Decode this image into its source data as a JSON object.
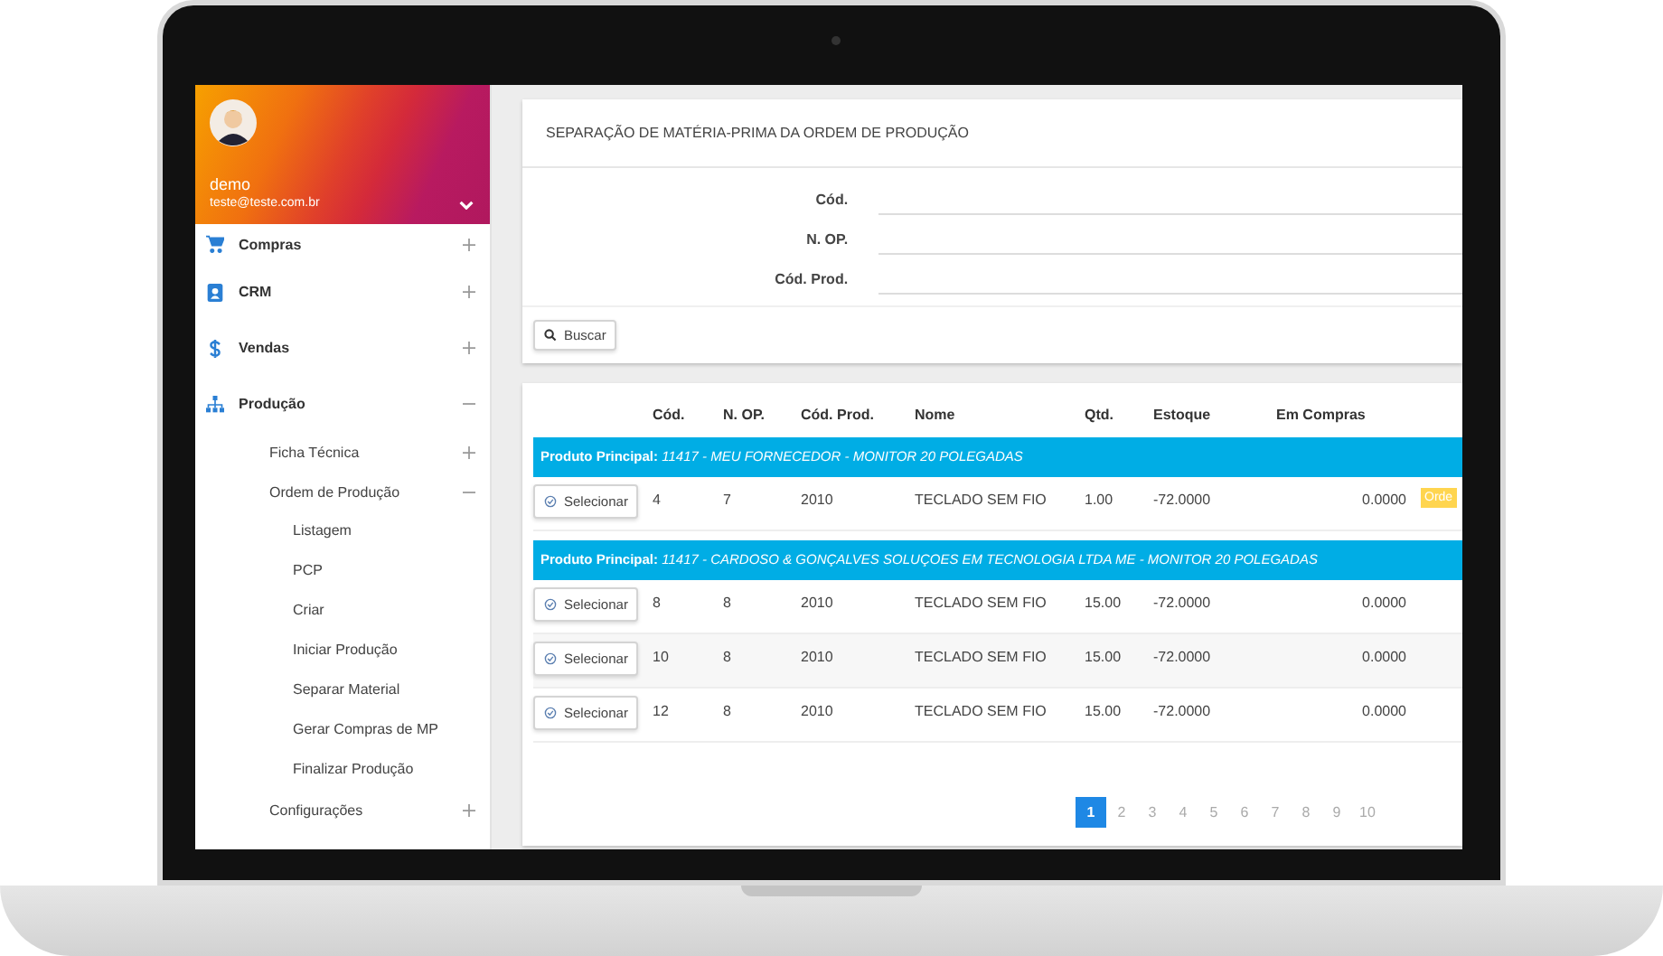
{
  "sidebar": {
    "user": {
      "name": "demo",
      "email": "teste@teste.com.br"
    },
    "items": [
      {
        "label": "Compras",
        "expanded": false
      },
      {
        "label": "CRM",
        "expanded": false
      },
      {
        "label": "Vendas",
        "expanded": false
      },
      {
        "label": "Produção",
        "expanded": true,
        "children": [
          {
            "label": "Ficha Técnica",
            "expanded": false
          },
          {
            "label": "Ordem de Produção",
            "expanded": true,
            "children": [
              {
                "label": "Listagem"
              },
              {
                "label": "PCP"
              },
              {
                "label": "Criar"
              },
              {
                "label": "Iniciar Produção"
              },
              {
                "label": "Separar Material"
              },
              {
                "label": "Gerar Compras de MP"
              },
              {
                "label": "Finalizar Produção"
              }
            ]
          },
          {
            "label": "Configurações",
            "expanded": false
          }
        ]
      }
    ]
  },
  "search_card": {
    "title": "SEPARAÇÃO DE MATÉRIA-PRIMA DA ORDEM DE PRODUÇÃO",
    "fields": [
      {
        "label": "Cód."
      },
      {
        "label": "N. OP."
      },
      {
        "label": "Cód. Prod."
      }
    ],
    "button": "Buscar"
  },
  "table": {
    "columns": [
      "Cód.",
      "N. OP.",
      "Cód. Prod.",
      "Nome",
      "Qtd.",
      "Estoque",
      "Em Compras"
    ],
    "groups": [
      {
        "label": "Produto Principal:",
        "value": "11417 - MEU FORNECEDOR - MONITOR 20 POLEGADAS",
        "rows": [
          {
            "button": "Selecionar",
            "cells": [
              "4",
              "7",
              "2010",
              "TECLADO SEM FIO",
              "1.00",
              "-72.0000",
              "0.0000"
            ],
            "badge": "Orde"
          }
        ]
      },
      {
        "label": "Produto Principal:",
        "value": "11417 - CARDOSO & GONÇALVES SOLUÇOES EM TECNOLOGIA LTDA ME - MONITOR 20 POLEGADAS",
        "rows": [
          {
            "button": "Selecionar",
            "cells": [
              "8",
              "8",
              "2010",
              "TECLADO SEM FIO",
              "15.00",
              "-72.0000",
              "0.0000"
            ]
          },
          {
            "button": "Selecionar",
            "cells": [
              "10",
              "8",
              "2010",
              "TECLADO SEM FIO",
              "15.00",
              "-72.0000",
              "0.0000"
            ]
          },
          {
            "button": "Selecionar",
            "cells": [
              "12",
              "8",
              "2010",
              "TECLADO SEM FIO",
              "15.00",
              "-72.0000",
              "0.0000"
            ]
          }
        ]
      }
    ]
  },
  "pagination": [
    {
      "label": "1",
      "selected": true
    },
    {
      "label": "2",
      "selected": false
    },
    {
      "label": "3",
      "selected": false
    },
    {
      "label": "4",
      "selected": false
    },
    {
      "label": "5",
      "selected": false
    },
    {
      "label": "6",
      "selected": false
    },
    {
      "label": "7",
      "selected": false
    },
    {
      "label": "8",
      "selected": false
    },
    {
      "label": "9",
      "selected": false
    },
    {
      "label": "10",
      "selected": false
    }
  ]
}
